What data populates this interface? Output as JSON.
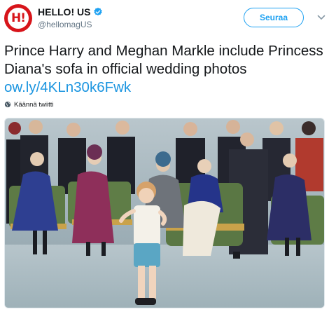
{
  "account": {
    "display_name": "HELLO! US",
    "handle": "@hellomagUS",
    "avatar_text": "H!",
    "verified": true
  },
  "follow_button": {
    "label": "Seuraa"
  },
  "tweet": {
    "text": "Prince Harry and Meghan Markle include Princess Diana's sofa in official wedding photos ",
    "link": "ow.ly/4KLn30k6Fwk"
  },
  "translate": {
    "label": "Käännä twiitti"
  },
  "colors": {
    "brand_red": "#d7141a",
    "accent_blue": "#1da1f2",
    "link_blue": "#1b95e0",
    "muted": "#657786"
  },
  "icons": {
    "verified": "verified-badge-icon",
    "caret": "chevron-down-icon",
    "globe": "globe-icon"
  }
}
